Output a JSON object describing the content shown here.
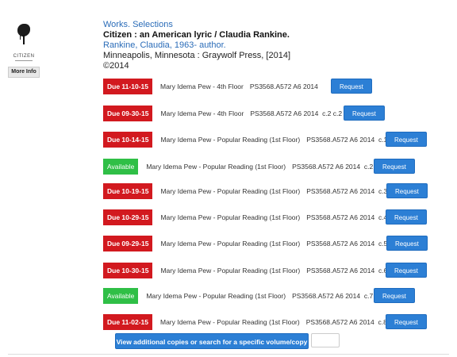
{
  "cover": {
    "title": "CITIZEN"
  },
  "more_info": "More Info",
  "record": {
    "series": "Works. Selections",
    "title": "Citizen : an American lyric / Claudia Rankine.",
    "author": "Rankine, Claudia, 1963- author.",
    "publisher": "Minneapolis, Minnesota : Graywolf Press, [2014]",
    "copyright": "©2014"
  },
  "copies": [
    {
      "status": "Due 11-10-15",
      "available": false,
      "location": "Mary Idema Pew - 4th Floor",
      "call": "PS3568.A572 A6 2014",
      "request": "Request"
    },
    {
      "status": "Due 09-30-15",
      "available": false,
      "location": "Mary Idema Pew - 4th Floor",
      "call": "PS3568.A572 A6 2014  c.2 c.2",
      "request": "Request"
    },
    {
      "status": "Due 10-14-15",
      "available": false,
      "location": "Mary Idema Pew - Popular Reading (1st Floor)",
      "call": "PS3568.A572 A6 2014  c.1",
      "request": "Request"
    },
    {
      "status": "Available",
      "available": true,
      "location": "Mary Idema Pew - Popular Reading (1st Floor)",
      "call": "PS3568.A572 A6 2014  c.2",
      "request": "Request"
    },
    {
      "status": "Due 10-19-15",
      "available": false,
      "location": "Mary Idema Pew - Popular Reading (1st Floor)",
      "call": "PS3568.A572 A6 2014  c.3",
      "request": "Request"
    },
    {
      "status": "Due 10-29-15",
      "available": false,
      "location": "Mary Idema Pew - Popular Reading (1st Floor)",
      "call": "PS3568.A572 A6 2014  c.4",
      "request": "Request"
    },
    {
      "status": "Due 09-29-15",
      "available": false,
      "location": "Mary Idema Pew - Popular Reading (1st Floor)",
      "call": "PS3568.A572 A6 2014  c.5",
      "request": "Request"
    },
    {
      "status": "Due 10-30-15",
      "available": false,
      "location": "Mary Idema Pew - Popular Reading (1st Floor)",
      "call": "PS3568.A572 A6 2014  c.6",
      "request": "Request"
    },
    {
      "status": "Available",
      "available": true,
      "location": "Mary Idema Pew - Popular Reading (1st Floor)",
      "call": "PS3568.A572 A6 2014  c.7",
      "request": "Request"
    },
    {
      "status": "Due 11-02-15",
      "available": false,
      "location": "Mary Idema Pew - Popular Reading (1st Floor)",
      "call": "PS3568.A572 A6 2014  c.8",
      "request": "Request"
    }
  ],
  "view_more": "View additional copies or search for a specific volume/copy",
  "colors": {
    "due": "#d2191f",
    "available": "#2fbf46",
    "button": "#2c7fd5",
    "link": "#2a6cb8"
  }
}
